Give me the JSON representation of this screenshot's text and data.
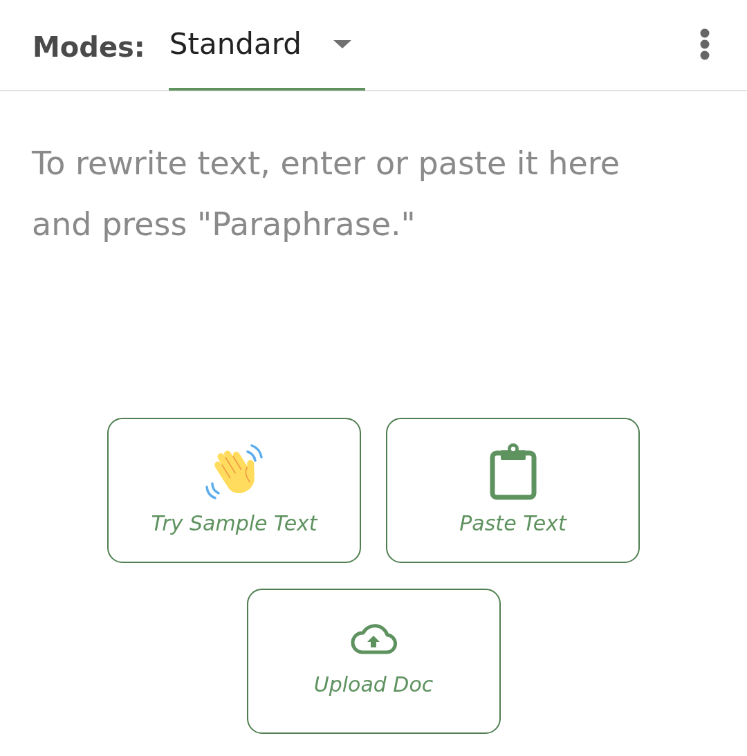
{
  "toolbar": {
    "label": "Modes:",
    "tabs": [
      {
        "label": "Standard",
        "selected": true
      }
    ]
  },
  "editor": {
    "placeholder": "To rewrite text, enter or paste it here and press \"Paraphrase.\""
  },
  "actions": [
    {
      "kind": "sample",
      "label": "Try Sample Text"
    },
    {
      "kind": "paste",
      "label": "Paste Text"
    },
    {
      "kind": "upload",
      "label": "Upload Doc"
    }
  ]
}
